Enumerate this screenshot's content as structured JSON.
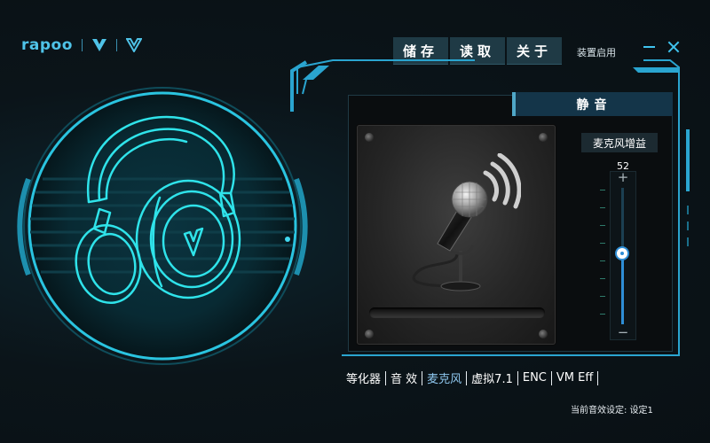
{
  "logo": {
    "brand": "rapoo"
  },
  "titlebar": {
    "tabs": [
      "储存",
      "读取",
      "关于"
    ],
    "device_enable": "装置启用"
  },
  "panel": {
    "mute_label": "静音",
    "gain_label": "麦克风增益",
    "gain_value": "52",
    "gain_fraction": 0.52
  },
  "tabs": [
    {
      "label": "等化器",
      "active": false
    },
    {
      "label": "音 效",
      "active": false
    },
    {
      "label": "麦克风",
      "active": true
    },
    {
      "label": "虚拟7.1",
      "active": false
    },
    {
      "label": "ENC",
      "active": false
    },
    {
      "label": "VM Eff",
      "active": false
    }
  ],
  "status": {
    "text": "当前音效设定: 设定1"
  },
  "colors": {
    "accent": "#40c4ef",
    "headphone": "#2fe3ea",
    "slider": "#2e8ed6"
  }
}
